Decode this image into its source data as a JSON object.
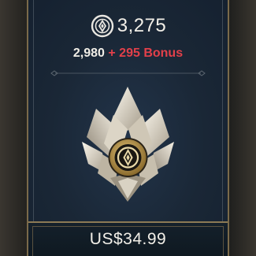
{
  "offer": {
    "total": "3,275",
    "base": "2,980",
    "plus": "+ 295 Bonus",
    "price": "US$34.99"
  },
  "icons": {
    "currency": "currency-coin-icon",
    "bundle": "crystal-bundle-icon"
  },
  "colors": {
    "bonus": "#e2404a",
    "gold": "#c9a45a",
    "panel": "#1a2736"
  }
}
